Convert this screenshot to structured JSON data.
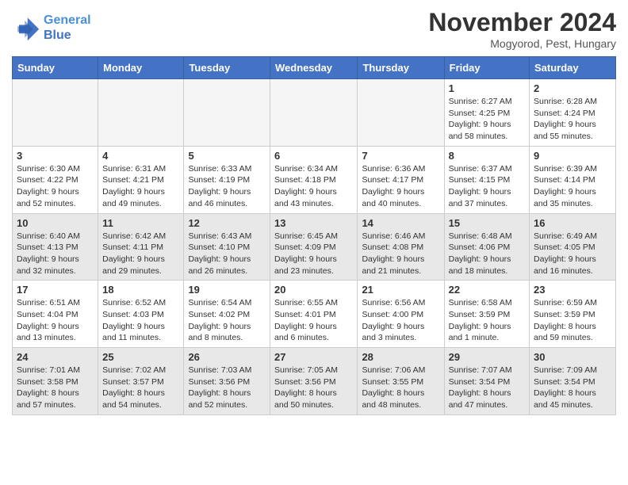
{
  "header": {
    "logo_line1": "General",
    "logo_line2": "Blue",
    "month_title": "November 2024",
    "location": "Mogyorod, Pest, Hungary"
  },
  "weekdays": [
    "Sunday",
    "Monday",
    "Tuesday",
    "Wednesday",
    "Thursday",
    "Friday",
    "Saturday"
  ],
  "weeks": [
    [
      {
        "day": "",
        "info": "",
        "empty": true
      },
      {
        "day": "",
        "info": "",
        "empty": true
      },
      {
        "day": "",
        "info": "",
        "empty": true
      },
      {
        "day": "",
        "info": "",
        "empty": true
      },
      {
        "day": "",
        "info": "",
        "empty": true
      },
      {
        "day": "1",
        "info": "Sunrise: 6:27 AM\nSunset: 4:25 PM\nDaylight: 9 hours\nand 58 minutes."
      },
      {
        "day": "2",
        "info": "Sunrise: 6:28 AM\nSunset: 4:24 PM\nDaylight: 9 hours\nand 55 minutes."
      }
    ],
    [
      {
        "day": "3",
        "info": "Sunrise: 6:30 AM\nSunset: 4:22 PM\nDaylight: 9 hours\nand 52 minutes."
      },
      {
        "day": "4",
        "info": "Sunrise: 6:31 AM\nSunset: 4:21 PM\nDaylight: 9 hours\nand 49 minutes."
      },
      {
        "day": "5",
        "info": "Sunrise: 6:33 AM\nSunset: 4:19 PM\nDaylight: 9 hours\nand 46 minutes."
      },
      {
        "day": "6",
        "info": "Sunrise: 6:34 AM\nSunset: 4:18 PM\nDaylight: 9 hours\nand 43 minutes."
      },
      {
        "day": "7",
        "info": "Sunrise: 6:36 AM\nSunset: 4:17 PM\nDaylight: 9 hours\nand 40 minutes."
      },
      {
        "day": "8",
        "info": "Sunrise: 6:37 AM\nSunset: 4:15 PM\nDaylight: 9 hours\nand 37 minutes."
      },
      {
        "day": "9",
        "info": "Sunrise: 6:39 AM\nSunset: 4:14 PM\nDaylight: 9 hours\nand 35 minutes."
      }
    ],
    [
      {
        "day": "10",
        "info": "Sunrise: 6:40 AM\nSunset: 4:13 PM\nDaylight: 9 hours\nand 32 minutes."
      },
      {
        "day": "11",
        "info": "Sunrise: 6:42 AM\nSunset: 4:11 PM\nDaylight: 9 hours\nand 29 minutes."
      },
      {
        "day": "12",
        "info": "Sunrise: 6:43 AM\nSunset: 4:10 PM\nDaylight: 9 hours\nand 26 minutes."
      },
      {
        "day": "13",
        "info": "Sunrise: 6:45 AM\nSunset: 4:09 PM\nDaylight: 9 hours\nand 23 minutes."
      },
      {
        "day": "14",
        "info": "Sunrise: 6:46 AM\nSunset: 4:08 PM\nDaylight: 9 hours\nand 21 minutes."
      },
      {
        "day": "15",
        "info": "Sunrise: 6:48 AM\nSunset: 4:06 PM\nDaylight: 9 hours\nand 18 minutes."
      },
      {
        "day": "16",
        "info": "Sunrise: 6:49 AM\nSunset: 4:05 PM\nDaylight: 9 hours\nand 16 minutes."
      }
    ],
    [
      {
        "day": "17",
        "info": "Sunrise: 6:51 AM\nSunset: 4:04 PM\nDaylight: 9 hours\nand 13 minutes."
      },
      {
        "day": "18",
        "info": "Sunrise: 6:52 AM\nSunset: 4:03 PM\nDaylight: 9 hours\nand 11 minutes."
      },
      {
        "day": "19",
        "info": "Sunrise: 6:54 AM\nSunset: 4:02 PM\nDaylight: 9 hours\nand 8 minutes."
      },
      {
        "day": "20",
        "info": "Sunrise: 6:55 AM\nSunset: 4:01 PM\nDaylight: 9 hours\nand 6 minutes."
      },
      {
        "day": "21",
        "info": "Sunrise: 6:56 AM\nSunset: 4:00 PM\nDaylight: 9 hours\nand 3 minutes."
      },
      {
        "day": "22",
        "info": "Sunrise: 6:58 AM\nSunset: 3:59 PM\nDaylight: 9 hours\nand 1 minute."
      },
      {
        "day": "23",
        "info": "Sunrise: 6:59 AM\nSunset: 3:59 PM\nDaylight: 8 hours\nand 59 minutes."
      }
    ],
    [
      {
        "day": "24",
        "info": "Sunrise: 7:01 AM\nSunset: 3:58 PM\nDaylight: 8 hours\nand 57 minutes."
      },
      {
        "day": "25",
        "info": "Sunrise: 7:02 AM\nSunset: 3:57 PM\nDaylight: 8 hours\nand 54 minutes."
      },
      {
        "day": "26",
        "info": "Sunrise: 7:03 AM\nSunset: 3:56 PM\nDaylight: 8 hours\nand 52 minutes."
      },
      {
        "day": "27",
        "info": "Sunrise: 7:05 AM\nSunset: 3:56 PM\nDaylight: 8 hours\nand 50 minutes."
      },
      {
        "day": "28",
        "info": "Sunrise: 7:06 AM\nSunset: 3:55 PM\nDaylight: 8 hours\nand 48 minutes."
      },
      {
        "day": "29",
        "info": "Sunrise: 7:07 AM\nSunset: 3:54 PM\nDaylight: 8 hours\nand 47 minutes."
      },
      {
        "day": "30",
        "info": "Sunrise: 7:09 AM\nSunset: 3:54 PM\nDaylight: 8 hours\nand 45 minutes."
      }
    ]
  ]
}
